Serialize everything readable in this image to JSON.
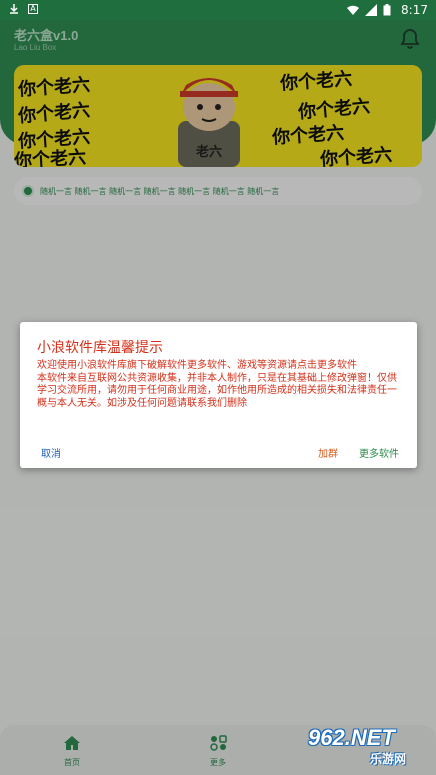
{
  "status_bar": {
    "time": "8:17"
  },
  "header": {
    "title": "老六盒v1.0",
    "subtitle": "Lao Liu Box"
  },
  "banner": {
    "text_lines": [
      "你个老六",
      "你个老六",
      "你个老六",
      "你个老六",
      "你个老六",
      "你个老六",
      "你个老六",
      "你个老六"
    ],
    "meme_caption": "老六"
  },
  "notice": {
    "text": "随机一言 随机一言 随机一言 随机一言 随机一言 随机一言 随机一言"
  },
  "dialog": {
    "title": "小浪软件库温馨提示",
    "body_line1": "欢迎使用小浪软件库旗下破解软件更多软件、游戏等资源请点击更多软件",
    "body_line2": "本软件来自互联网公共资源收集，并非本人制作，只是在其基础上修改弹窗！仅供学习交流所用，请勿用于任何商业用途，如作他用所造成的相关损失和法律责任一概与本人无关。如涉及任何问题请联系我们删除",
    "cancel_label": "取消",
    "group_label": "加群",
    "more_label": "更多软件"
  },
  "bottom_nav": {
    "items": [
      {
        "label": "首页",
        "icon": "home-icon"
      },
      {
        "label": "更多",
        "icon": "more-icon"
      }
    ]
  },
  "watermark": {
    "brand": "962.NET",
    "sub": "乐游网"
  },
  "colors": {
    "primary": "#2f8a52",
    "dialog_text": "#d42f1a",
    "banner_bg": "#f2e220"
  }
}
